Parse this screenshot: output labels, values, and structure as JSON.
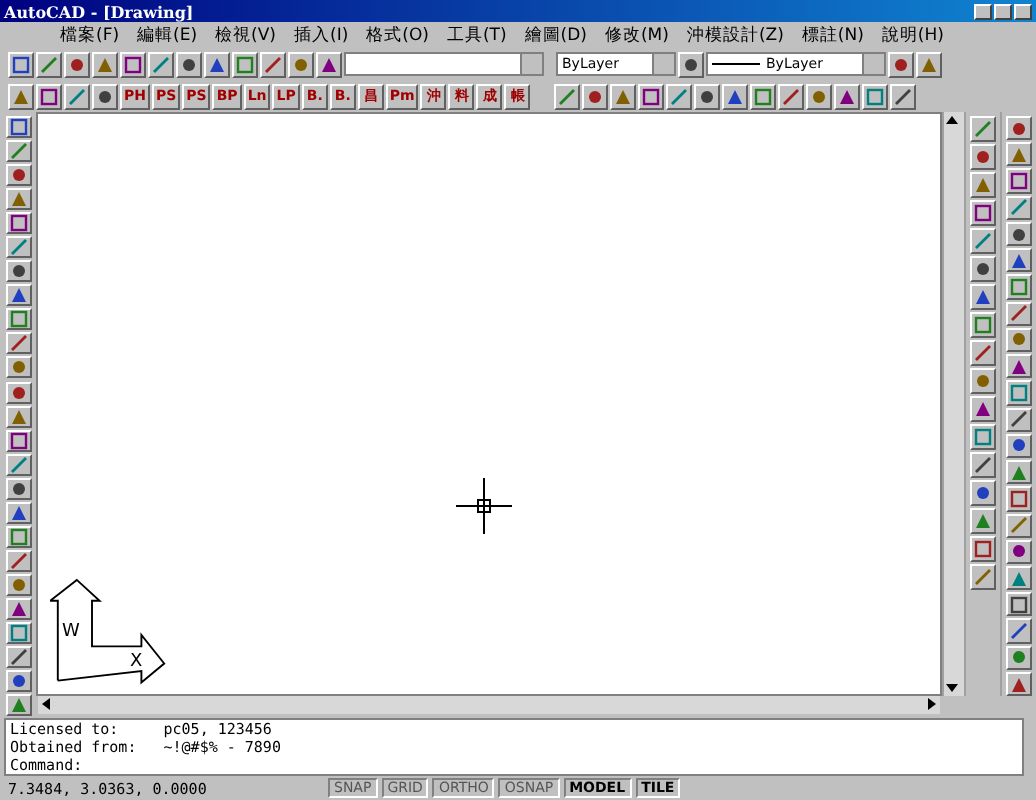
{
  "window": {
    "title": "AutoCAD - [Drawing]"
  },
  "menu": [
    "檔案(F)",
    "編輯(E)",
    "檢視(V)",
    "插入(I)",
    "格式(O)",
    "工具(T)",
    "繪圖(D)",
    "修改(M)",
    "沖模設計(Z)",
    "標註(N)",
    "說明(H)"
  ],
  "properties_toolbar": {
    "color_dropdown": "ByLayer",
    "linetype_dropdown": "ByLayer"
  },
  "custom_toolbar": {
    "buttons": [
      "PH",
      "PS",
      "PS",
      "BP",
      "Ln",
      "LP",
      "B.",
      "B.",
      "昌",
      "Pm",
      "沖",
      "料",
      "成",
      "帳"
    ]
  },
  "ucs_icon": {
    "y_label": "W",
    "x_label": "X"
  },
  "command_window": {
    "lines": [
      "Licensed to:     pc05, 123456",
      "Obtained from:   ~!@#$% - 7890"
    ],
    "prompt": "Command:"
  },
  "status_bar": {
    "coordinates": "7.3484, 3.0363, 0.0000",
    "toggles": [
      {
        "label": "SNAP",
        "on": false
      },
      {
        "label": "GRID",
        "on": false
      },
      {
        "label": "ORTHO",
        "on": false
      },
      {
        "label": "OSNAP",
        "on": false
      },
      {
        "label": "MODEL",
        "on": true
      },
      {
        "label": "TILE",
        "on": true
      }
    ]
  }
}
